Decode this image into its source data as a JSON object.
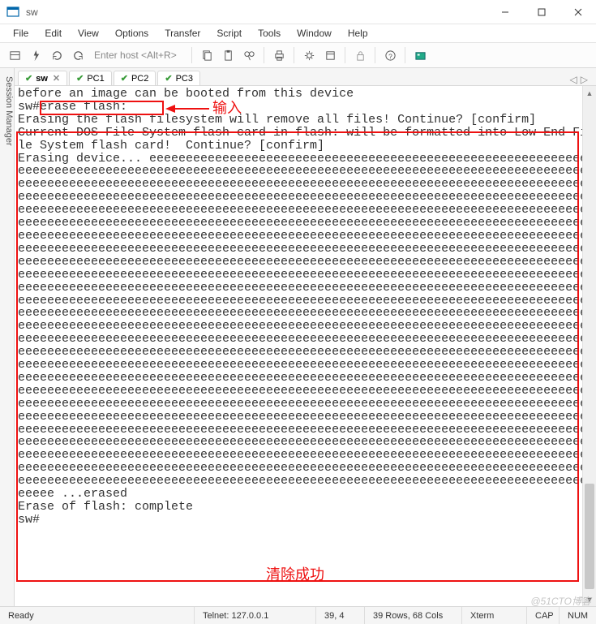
{
  "window": {
    "title": "sw"
  },
  "menu": {
    "items": [
      "File",
      "Edit",
      "View",
      "Options",
      "Transfer",
      "Script",
      "Tools",
      "Window",
      "Help"
    ]
  },
  "toolbar": {
    "host_placeholder": "Enter host <Alt+R>"
  },
  "sidebar": {
    "label": "Session Manager"
  },
  "tabs": {
    "items": [
      {
        "label": "sw",
        "active": true,
        "closable": true
      },
      {
        "label": "PC1",
        "active": false,
        "closable": false
      },
      {
        "label": "PC2",
        "active": false,
        "closable": false
      },
      {
        "label": "PC3",
        "active": false,
        "closable": false
      }
    ]
  },
  "terminal": {
    "lines": [
      "before an image can be booted from this device",
      "sw#erase flash:",
      "Erasing the flash filesystem will remove all files! Continue? [confirm]",
      "Current DOS File System flash card in flash: will be formatted into Low End File System flash card!  Continue? [confirm]",
      "Erasing device... eeeeeeeeeeeeeeeeeeeeeeeeeeeeeeeeeeeeeeeeeeeeeeeeeeeeeeeeeeeeeeeeeeeeeeeeeeeeeeeeeeeeeeeeeeeeeeeeeeeeeeeeeeeeeeeeeeeeeeeeeeeeeeeeeeeeeeeeeeeeeeeeeeeeeeeeeeeeeeeeeeeeeeeeeeeeeeeeeeeeeeeeeeeeeeeeeeeeeeeeeeeeeeeeeeeeeeeeeeeeeeeeeeeeeeeeeeeeeeeeeeeeeeeeeeeeeeeeeeeeeeeeeeeeeeeeeeeeeeeeeeeeeeeeeeeeeeeeeeeeeeeeeeeeeeeeeeeeeeeeeeeeeeeeeeeeeeeeeeeeeeeeeeeeeeeeeeeeeeeeeeeeeeeeeeeeeeeeeeeeeeeeeeeeeeeeeeeeeeeeeeeeeeeeeeeeeeeeeeeeeeeeeeeeeeeeeeeeeeeeeeeeeeeeeeeeeeeeeeeeeeeeeeeeeeeeeeeeeeeeeeeeeeeeeeeeeeeeeeeeeeeeeeeeeeeeeeeeeeeeeeeeeeeeeeeeeeeeeeeeeeeeeeeeeeeeeeeeeeeeeeeeeeeeeeeeeeeeeeeeeeeeeeeeeeeeeeeeeeeeeeeeeeeeeeeeeeeeeeeeeeeeeeeeeeeeeeeeeeeeeeeeeeeeeeeeeeeeeeeeeeeeeeeeeeeeeeeeeeeeeeeeeeeeeeeeeeeeeeeeeeeeeeeeeeeeeeeeeeeeeeeeeeeeeeeeeeeeeeeeeeeeeeeeeeeeeeeeeeeeeeeeeeeeeeeeeeeeeeeeeeeeeeeeeeeeeeeeeeeeeeeeeeeeeeeeeeeeeeeeeeeeeeeeeeeeeeeeeeeeeeeeeeeeeeeeeeeeeeeeeeeeeeeeeeeeeeeeeeeeeeeeeeeeeeeeeeeeeeeeeeeeeeeeeeeeeeeeeeeeeeeeeeeeeeeeeeeeeeeeeeeeeeeeeeeeeeeeeeeeeeeeeeeeeeeeeeeeeeeeeeeeeeeeeeeeeeeeeeeeeeeeeeeeeeeeeeeeeeeeeeeeeeeeeeeeeeeeeeeeeeeeeeeeeeeeeeeeeeeeeeeeeeeeeeeeeeeeeeeeeeeeeeeeeeeeeeeeeeeeeeeeeeeeeeeeeeeeeeeeeeeeeeeeeeeeeeeeeeeeeeeeeeeeeeeeeeeeeeeeeeeeeeeeeeeeeeeeeeeeeeeeeeeeeeeeeeeeeeeeeeeeeeeeeeeeeeeeeeeeeeeeeeeeeeeeeeeeeeeeeeeeeeeeeeeeeeeeeeeeeeeeeeeeeeeeeeeeeeeeeeeeeeeeeeeeeeeeeeeeeeeeeeeeeeeeeeeeeeeeeeeeeeeeeeeeeeeeeeeeeeeeeeeeeeeeeeeeeeeeeeeeeeeeeeeeeeeeeeeeeeeeeeeeeeeeeeeeeeeeeeeeeeeeeeeeeeeeeeeeeeeeeeeeeeeeeeeeeeeeeeeeeeeeeeeeeeeeeeeeeeeeeeeeeeeeeeeeeeeeeeeeeeeeeeeeeeeeeeeeeeeeeeeeeeeeeeeeeeeeeeeeeeeeeeeeeeeeeeeeeeeeeeeeeeeeeeeeeeeeeeeeeeeeeeeeeeeeeeeeeeeeeeeeeeeeeeeeeeeeeeeeeeeeeeeeeeeeeeeeeeeeeeeeeeeeeeeeeeeeeeeeeeeeeeeeeeeeeeeeeeeeeeeeeeeeeeeeeeeeeeeeeeeeeeeeeeeeeeeeeeeeeeeeeeeeeeeeeeeeeeeeeeeeeeeeeeeeeeeeeeeeeeeeeeeeeeeeeeeeeeeeeeeeeeeeeeeeeeeeeeeeeeeeeeeeeeeeeeeeeeeeeeeeeeeeeeeeeeeeeeeeeeeeeeeeeeeeeeeeeeeeeeeeeeeeeeeeeeeeeeeeeeeeeeeeeeeeeeeeeeeeeeeeeeeeeeeeeeeeeeeeeeeeeeeeeeeeeeeeeeeeeeeeeeeeeeeeeeeeeeeeeeeeeeeeeeeeeeeeeeeeeeeeeeeeeeeeeeeeeeeeeeeeeeeeeeeeeeeeeeeeeeeeeeeeeee ...erased",
      "Erase of flash: complete",
      "sw#"
    ]
  },
  "annotations": {
    "input_label": "输入",
    "success_label": "清除成功"
  },
  "status": {
    "ready": "Ready",
    "conn": "Telnet: 127.0.0.1",
    "cursor": "39,  4",
    "size": "39 Rows, 68 Cols",
    "term": "Xterm",
    "caps": "CAP",
    "num": "NUM"
  },
  "watermark": "@51CTO博客"
}
